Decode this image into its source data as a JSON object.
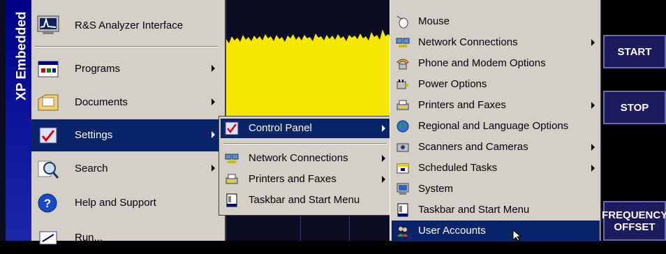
{
  "analyzer": {
    "softkeys": [
      {
        "label": "START"
      },
      {
        "label": "STOP"
      },
      {
        "label": "FREQUENCY OFFSET"
      }
    ],
    "colors": {
      "trace": "#f5e800",
      "background": "#0b0d22",
      "softkey": "#1b1b5e"
    }
  },
  "start_menu": {
    "banner": "XP Embedded",
    "pinned": {
      "label": "R&S Analyzer Interface",
      "icon": "analyzer-icon"
    },
    "items": [
      {
        "label": "Programs",
        "icon": "programs-icon",
        "submenu": true
      },
      {
        "label": "Documents",
        "icon": "documents-icon",
        "submenu": true
      },
      {
        "label": "Settings",
        "icon": "settings-icon",
        "submenu": true
      },
      {
        "label": "Search",
        "icon": "search-icon",
        "submenu": true
      },
      {
        "label": "Help and Support",
        "icon": "help-icon",
        "submenu": false
      },
      {
        "label": "Run...",
        "icon": "run-icon",
        "submenu": false
      }
    ]
  },
  "settings_menu": {
    "items": [
      {
        "label": "Control Panel",
        "icon": "control-panel-icon",
        "submenu": true
      },
      {
        "label": "Network Connections",
        "icon": "network-icon",
        "submenu": true
      },
      {
        "label": "Printers and Faxes",
        "icon": "printer-icon",
        "submenu": true
      },
      {
        "label": "Taskbar and Start Menu",
        "icon": "taskbar-icon",
        "submenu": false
      }
    ]
  },
  "control_panel_menu": {
    "items": [
      {
        "label": "Mouse",
        "icon": "mouse-icon",
        "submenu": false
      },
      {
        "label": "Network Connections",
        "icon": "network-icon",
        "submenu": true
      },
      {
        "label": "Phone and Modem Options",
        "icon": "phone-icon",
        "submenu": false
      },
      {
        "label": "Power Options",
        "icon": "power-icon",
        "submenu": false
      },
      {
        "label": "Printers and Faxes",
        "icon": "printer-icon",
        "submenu": true
      },
      {
        "label": "Regional and Language Options",
        "icon": "globe-icon",
        "submenu": false
      },
      {
        "label": "Scanners and Cameras",
        "icon": "scanner-icon",
        "submenu": true
      },
      {
        "label": "Scheduled Tasks",
        "icon": "scheduled-tasks-icon",
        "submenu": true
      },
      {
        "label": "System",
        "icon": "system-icon",
        "submenu": false
      },
      {
        "label": "Taskbar and Start Menu",
        "icon": "taskbar-icon",
        "submenu": false
      },
      {
        "label": "User Accounts",
        "icon": "user-accounts-icon",
        "submenu": false
      }
    ]
  },
  "menu_colors": {
    "face": "#d4d0c8",
    "highlight": "#0a246a",
    "banner": "#000088"
  }
}
